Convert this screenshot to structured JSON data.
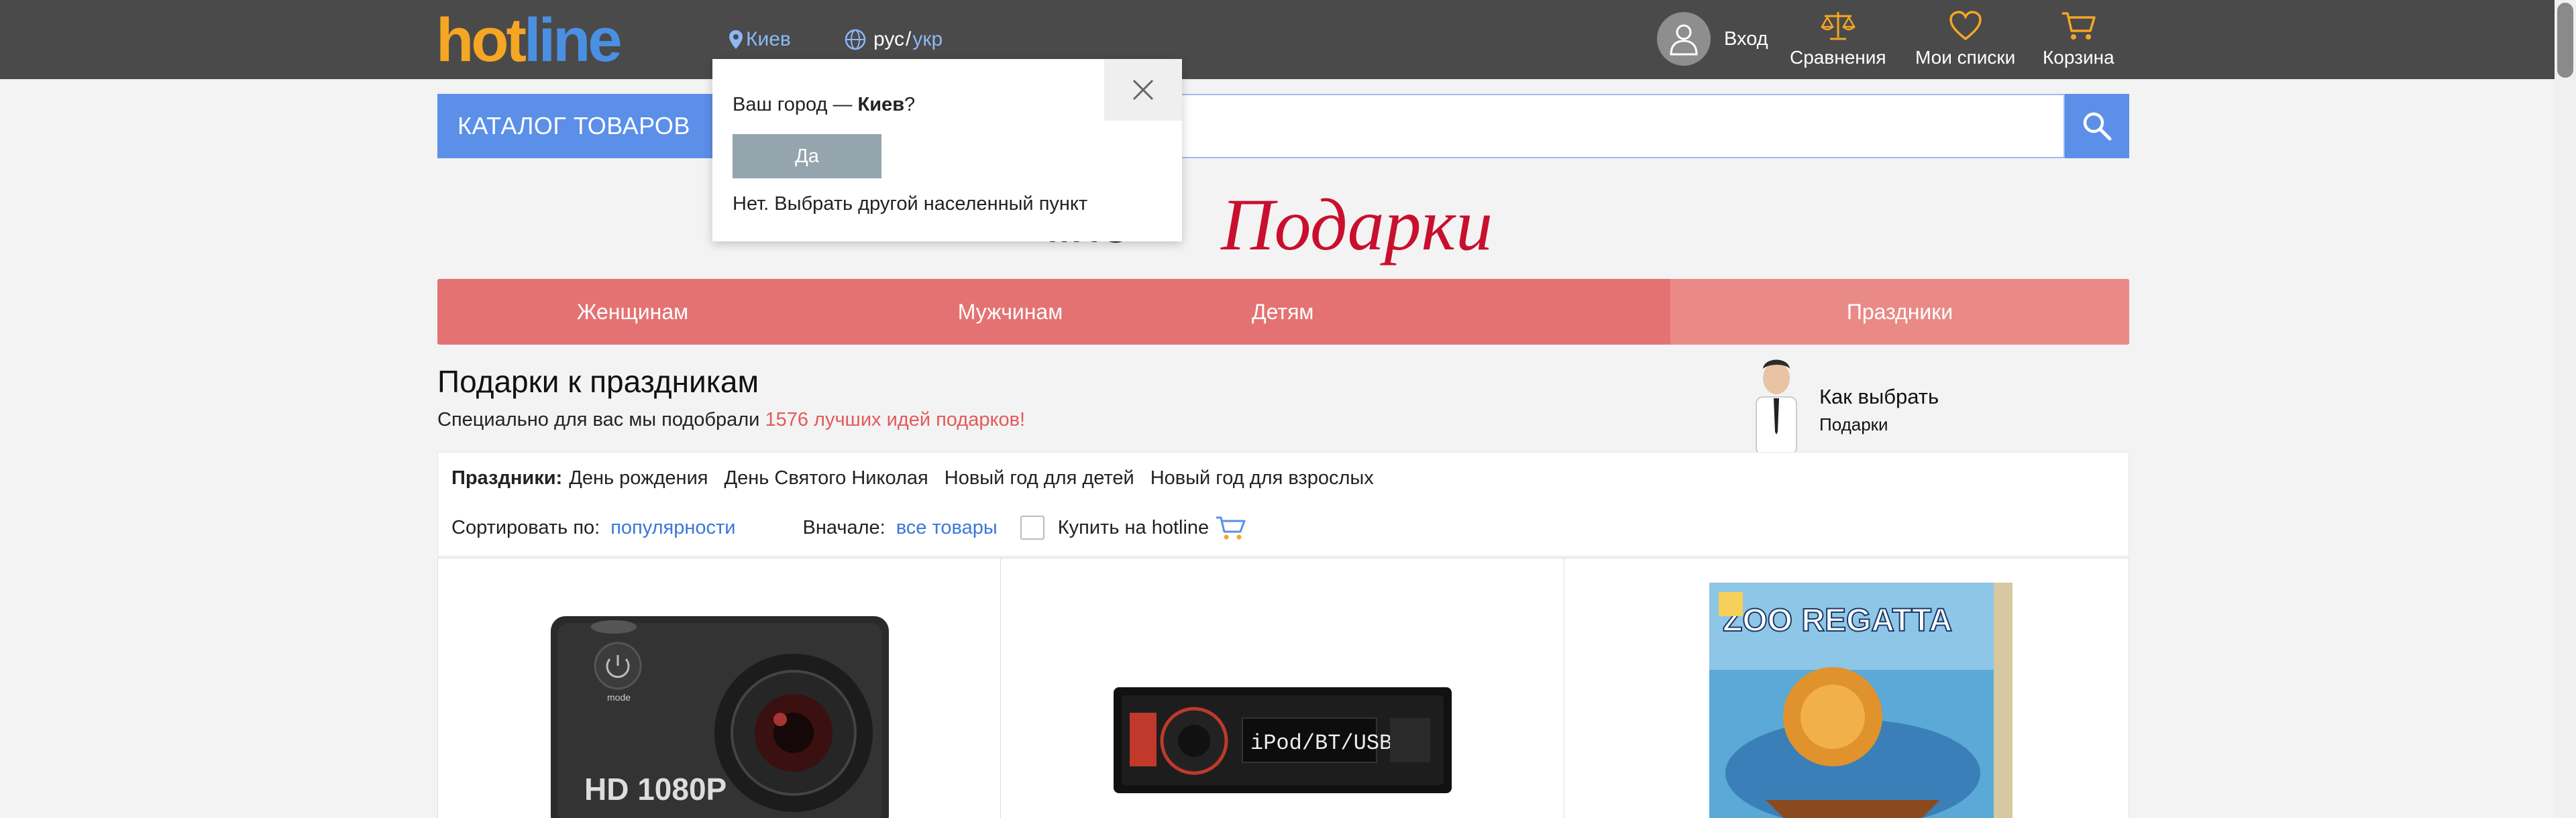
{
  "header": {
    "logo_hot": "hot",
    "logo_line": "line",
    "city": "Киев",
    "lang_current": "рус",
    "lang_sep": " / ",
    "lang_other": "укр",
    "login": "Вход",
    "compare": "Сравнения",
    "lists": "Мои списки",
    "cart": "Корзина"
  },
  "search": {
    "catalog_label": "КАТАЛОГ ТОВАРОВ",
    "value": ""
  },
  "banner": {
    "prefix": "line",
    "title": "Подарки"
  },
  "city_popup": {
    "question_prefix": "Ваш город — ",
    "question_city": "Киев",
    "question_suffix": "?",
    "yes_label": "Да",
    "no_label": "Нет. Выбрать другой населенный пункт"
  },
  "categories": [
    {
      "label": "Женщинам"
    },
    {
      "label": "Мужчинам"
    },
    {
      "label": "Детям"
    },
    {
      "label": "Праздники"
    }
  ],
  "main": {
    "title": "Подарки к праздникам",
    "subtitle_prefix": "Специально для вас мы подобрали ",
    "subtitle_highlight": "1576 лучших идей подарков!"
  },
  "howto": {
    "title": "Как выбрать",
    "subtitle": "Подарки"
  },
  "filters": {
    "holidays_label": "Праздники:",
    "holidays": [
      "День рождения",
      "День Святого Николая",
      "Новый год для детей",
      "Новый год для взрослых"
    ],
    "sort_label": "Сортировать по:",
    "sort_value": "популярности",
    "first_label": "Вначале:",
    "first_value": "все товары",
    "buy_label": "Купить на hotline"
  },
  "products": [
    {
      "name": "action-camera",
      "badge": "HD 1080P",
      "button": "mode"
    },
    {
      "name": "car-radio",
      "display": "iPod/BT/USB"
    },
    {
      "name": "board-game",
      "title": "ZOO REGATTA"
    }
  ],
  "colors": {
    "header_bg": "#4a4a4a",
    "accent_blue": "#5b8fe8",
    "category_red": "#e57272",
    "highlight_red": "#e45a5a"
  }
}
